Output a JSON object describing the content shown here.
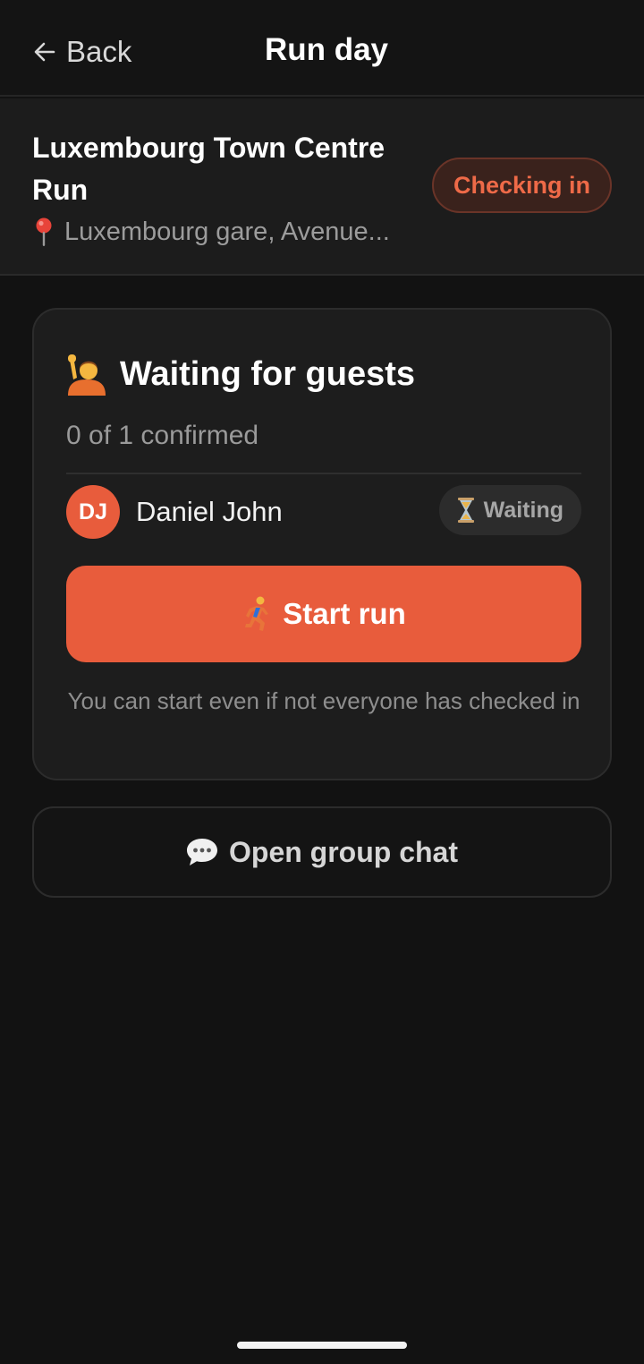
{
  "header": {
    "back_label": "Back",
    "title": "Run day"
  },
  "event": {
    "title": "Luxembourg Town Centre Run",
    "location": "Luxembourg gare, Avenue...",
    "status": "Checking in"
  },
  "guests_card": {
    "heading": "Waiting for guests",
    "confirmed": "0 of 1 confirmed",
    "guests": [
      {
        "initials": "DJ",
        "name": "Daniel John",
        "status": "Waiting"
      }
    ],
    "start_label": "Start run",
    "hint": "You can start even if not everyone has checked in"
  },
  "chat": {
    "label": "Open group chat"
  },
  "colors": {
    "accent": "#e85c3c",
    "background": "#121212",
    "card": "#1d1d1d"
  },
  "icons": {
    "back": "arrow-left-icon",
    "location": "pin-icon",
    "heading": "raising-hand-icon",
    "guest_status": "hourglass-icon",
    "start": "runner-icon",
    "chat": "speech-bubble-icon"
  }
}
